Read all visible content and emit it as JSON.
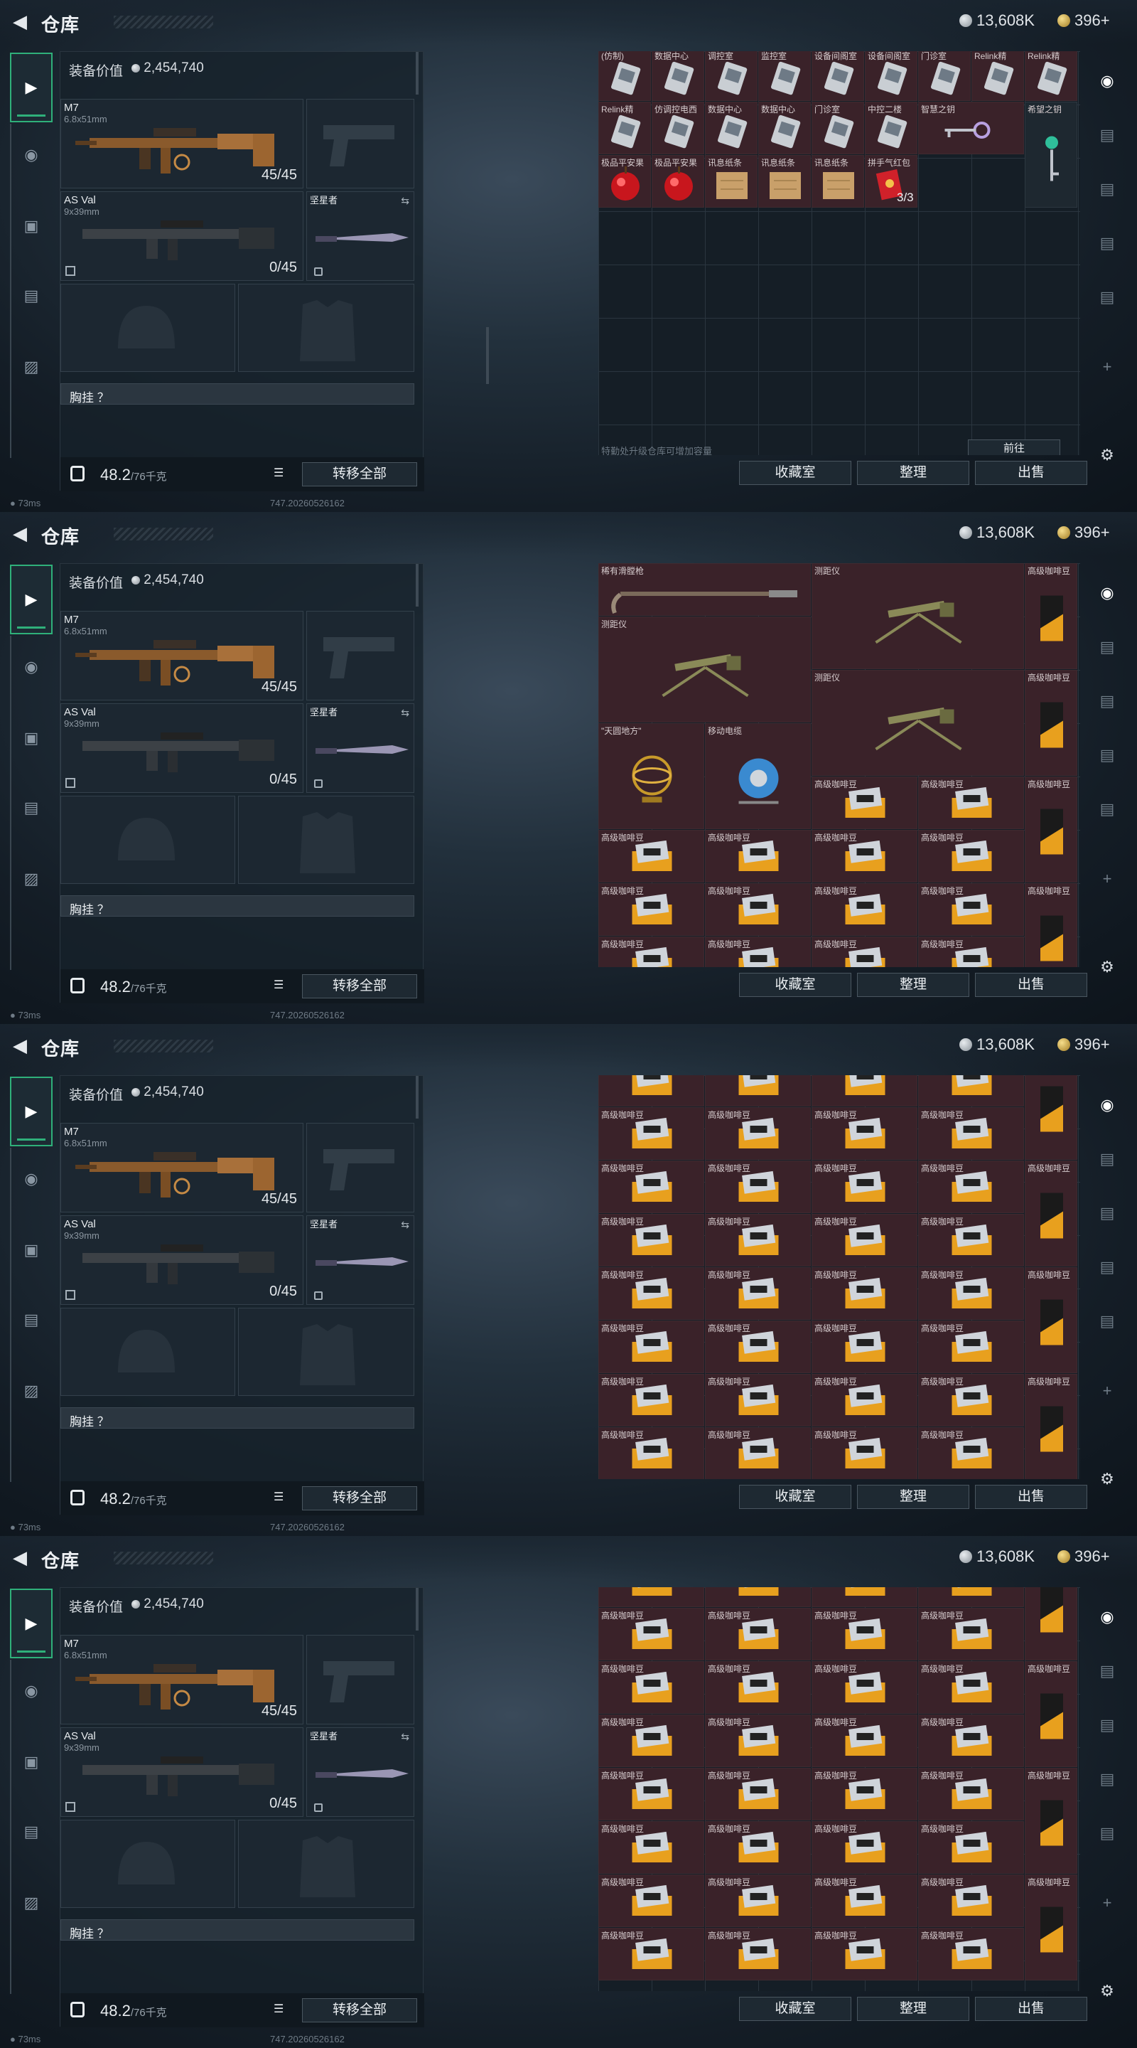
{
  "header": {
    "title": "仓库",
    "back_icon": "back-arrow-icon",
    "silver": "13,608K",
    "gold": "396+"
  },
  "equipment": {
    "label": "装备价值",
    "value": "2,454,740",
    "primary": {
      "name": "M7",
      "caliber": "6.8x51mm",
      "ammo": "45/45"
    },
    "secondary": {
      "name": "AS Val",
      "caliber": "9x39mm",
      "ammo": "0/45"
    },
    "melee": {
      "name": "坚星者"
    },
    "chest_label": "胸挂 ？",
    "weight": "48.2",
    "weight_max": "/76千克",
    "transfer_all": "转移全部"
  },
  "left_tabs": [
    "gun-icon",
    "helmet-icon",
    "backpack-icon",
    "clipboard-icon",
    "briefcase-icon"
  ],
  "right_tabs": [
    "vault-icon",
    "stash-icon",
    "stash-icon",
    "stash-icon",
    "stash-icon",
    "plus-icon",
    "gear-icon"
  ],
  "stash_buttons": {
    "collection": "收藏室",
    "sort": "整理",
    "sell": "出售"
  },
  "status": {
    "ping": "73ms",
    "build": "747.20260526162"
  },
  "screen1": {
    "row1": [
      "(仿制)",
      "数据中心",
      "调控室",
      "监控室",
      "设备间阁室",
      "设备间阁室",
      "门诊室",
      "Relink精",
      "Relink精"
    ],
    "row2": [
      "Relink精",
      "仿调控电西",
      "数据中心",
      "数据中心",
      "门诊室",
      "中控二楼",
      "智慧之钥",
      "希望之钥"
    ],
    "row3": [
      "极品平安果",
      "极品平安果",
      "讯息纸条",
      "讯息纸条",
      "讯息纸条",
      "拼手气红包"
    ],
    "hongbao_count": "3/3",
    "upgrade_tip": "特勤处升级仓库可增加容量",
    "goto": "前往"
  },
  "screen2": {
    "rifle": "稀有滑膛枪",
    "rangefinder": "测距仪",
    "armillary": "\"天圆地方\"",
    "cable_reel": "移动电缆",
    "coffee": "高级咖啡豆"
  }
}
